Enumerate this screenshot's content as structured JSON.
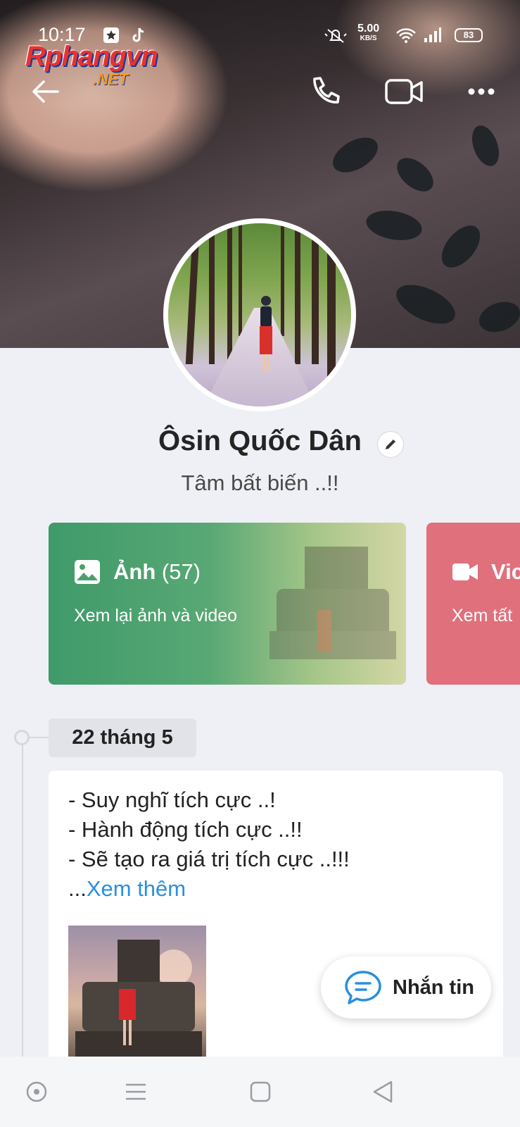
{
  "status_bar": {
    "time": "10:17",
    "speed_value": "5.00",
    "speed_unit": "KB/S",
    "battery": "83"
  },
  "watermark": {
    "brand": "Rphangvn",
    "suffix": ".NET"
  },
  "header": {
    "icons": [
      "back-arrow-icon",
      "phone-icon",
      "video-call-icon",
      "more-icon"
    ]
  },
  "profile": {
    "name": "Ôsin Quốc Dân",
    "bio": "Tâm bất biến ..!!"
  },
  "cards": {
    "photos": {
      "label": "Ảnh",
      "count": "(57)",
      "subtitle": "Xem lại ảnh và video"
    },
    "video": {
      "label": "Vic",
      "subtitle": "Xem tất"
    }
  },
  "timeline": {
    "date": "22 tháng 5",
    "post": {
      "lines": [
        "- Suy nghĩ tích cực ..!",
        "- Hành động tích cực ..!!",
        "- Sẽ tạo ra giá trị tích cực ..!!!"
      ],
      "ellipsis": "...",
      "more_link": "Xem thêm"
    }
  },
  "message_button": {
    "label": "Nhắn tin"
  },
  "colors": {
    "photos_card": "#3f9a6a",
    "video_card": "#e0707c",
    "link": "#2a8fe0",
    "message_icon": "#2a8fe0"
  }
}
